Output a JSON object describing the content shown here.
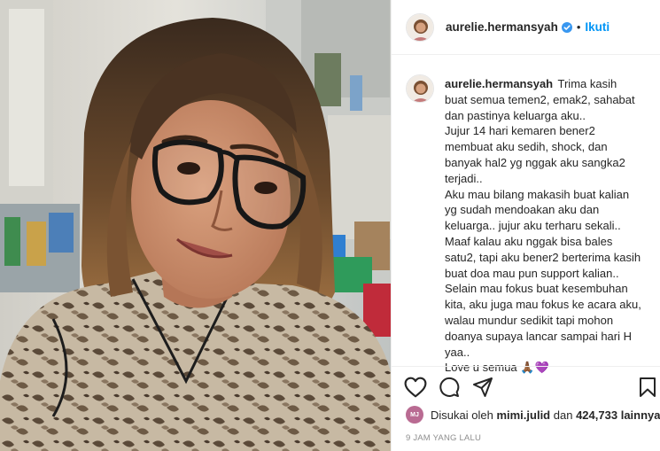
{
  "post": {
    "username": "aurelie.hermansyah",
    "follow_label": "Ikuti",
    "separator": "•",
    "caption_lines": [
      "Trima kasih",
      "buat semua temen2, emak2, sahabat",
      "dan pastinya keluarga aku..",
      "Jujur 14 hari kemaren bener2",
      "membuat aku sedih, shock, dan",
      "banyak hal2 yg nggak aku sangka2",
      "terjadi..",
      "Aku mau bilang makasih buat kalian",
      "yg sudah mendoakan aku dan",
      "keluarga.. jujur aku terharu sekali..",
      "Maaf kalau aku nggak bisa bales",
      "satu2, tapi aku bener2 berterima kasih",
      "buat doa mau pun support kalian..",
      "Selain mau fokus buat kesembuhan",
      "kita, aku juga mau fokus ke acara aku,",
      "walau mundur sedikit tapi mohon",
      "doanya supaya lancar sampai hari H",
      "yaa..",
      "Love u semua 🙏🏾💜"
    ],
    "likes": {
      "prefix": "Disukai oleh",
      "liker": "mimi.julid",
      "conjunction": "dan",
      "count": "424,733",
      "suffix": "lainnya",
      "liker_avatar_text": "MJ"
    },
    "timestamp": "9 JAM YANG LALU"
  },
  "icons": {
    "like": "heart-icon",
    "comment": "comment-icon",
    "share": "send-icon",
    "save": "bookmark-icon",
    "verified": "verified-badge-icon"
  },
  "colors": {
    "accent": "#0095f6",
    "text": "#262626",
    "muted": "#8e8e8e",
    "border": "#efefef"
  }
}
